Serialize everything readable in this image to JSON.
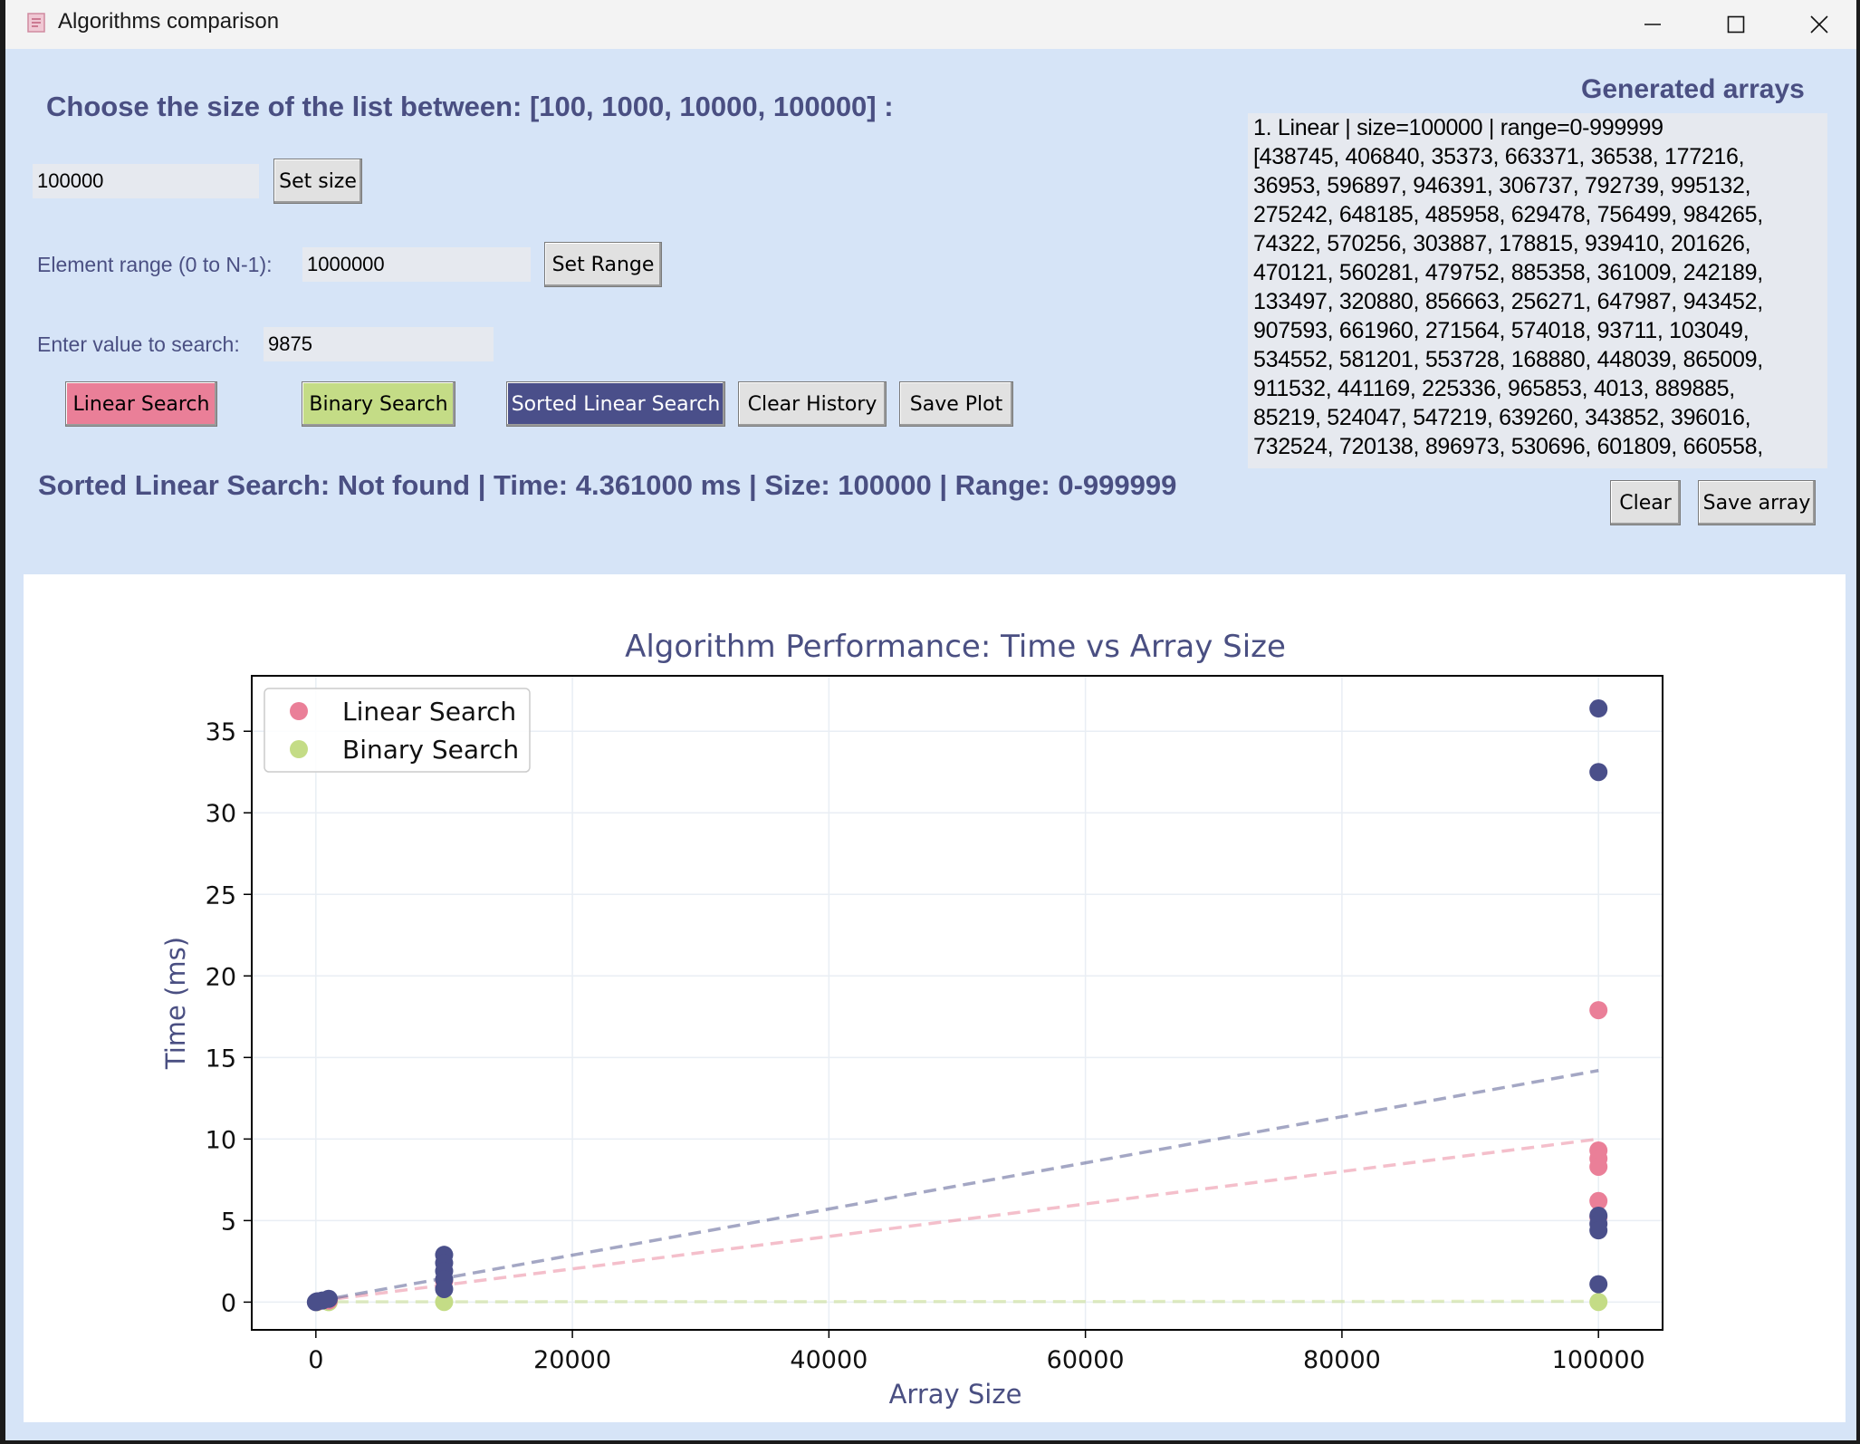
{
  "window": {
    "title": "Algorithms comparison"
  },
  "controls": {
    "size_prompt": "Choose the size of the list between: [100, 1000, 10000, 100000] :",
    "size_value": "100000",
    "set_size_label": "Set size",
    "range_label": "Element range (0 to N-1):",
    "range_value": "1000000",
    "set_range_label": "Set Range",
    "search_label": "Enter value to search:",
    "search_value": "9875",
    "linear_label": "Linear Search",
    "binary_label": "Binary Search",
    "sorted_label": "Sorted Linear Search",
    "clear_history_label": "Clear History",
    "save_plot_label": "Save Plot"
  },
  "status": "Sorted Linear Search: Not found | Time: 4.361000 ms | Size: 100000 | Range: 0-999999",
  "generated": {
    "title": "Generated arrays",
    "lines": [
      "1. Linear | size=100000 | range=0-999999",
      "[438745, 406840, 35373, 663371, 36538, 177216,",
      "36953, 596897, 946391, 306737, 792739, 995132,",
      "275242, 648185, 485958, 629478, 756499, 984265,",
      "74322, 570256, 303887, 178815, 939410, 201626,",
      "470121, 560281, 479752, 885358, 361009, 242189,",
      "133497, 320880, 856663, 256271, 647987, 943452,",
      "907593, 661960, 271564, 574018, 93711, 103049,",
      "534552, 581201, 553728, 168880, 448039, 865009,",
      "911532, 441169, 225336, 965853, 4013, 889885,",
      "85219, 524047, 547219, 639260, 343852, 396016,",
      "732524, 720138, 896973, 530696, 601809, 660558,"
    ],
    "clear_label": "Clear",
    "save_label": "Save array"
  },
  "colors": {
    "linear": "#ea7f98",
    "binary": "#c4dc86",
    "sorted": "#4a4f8a",
    "accent_text": "#4a4f82"
  },
  "chart_data": {
    "type": "scatter",
    "title": "Algorithm Performance: Time vs Array Size",
    "xlabel": "Array Size",
    "ylabel": "Time (ms)",
    "xlim": [
      -5000,
      105000
    ],
    "ylim": [
      -1.7,
      38.4
    ],
    "xticks": [
      0,
      20000,
      40000,
      60000,
      80000,
      100000
    ],
    "yticks": [
      0,
      5,
      10,
      15,
      20,
      25,
      30,
      35
    ],
    "grid": true,
    "legend": {
      "position": "top-left",
      "entries": [
        "Linear Search",
        "Binary Search"
      ]
    },
    "series": [
      {
        "name": "Linear Search",
        "color": "#ea7f98",
        "x": [
          100,
          1000,
          10000,
          100000,
          100000,
          100000,
          100000,
          100000,
          100000
        ],
        "y": [
          0.02,
          0.1,
          1.3,
          17.9,
          9.3,
          8.8,
          8.3,
          6.2,
          5.2
        ],
        "trend": [
          [
            0,
            0.05
          ],
          [
            100000,
            10.0
          ]
        ]
      },
      {
        "name": "Binary Search",
        "color": "#c4dc86",
        "x": [
          100,
          1000,
          10000,
          100000
        ],
        "y": [
          0.0,
          0.0,
          0.01,
          0.01
        ],
        "trend": [
          [
            0,
            0.02
          ],
          [
            100000,
            0.05
          ]
        ]
      },
      {
        "color": "#4a4f8a",
        "x": [
          0,
          100,
          500,
          1000,
          10000,
          10000,
          10000,
          10000,
          10000,
          100000,
          100000,
          100000,
          100000,
          100000,
          100000
        ],
        "y": [
          0.0,
          0.05,
          0.1,
          0.2,
          2.9,
          2.4,
          1.9,
          1.4,
          0.8,
          36.4,
          32.5,
          5.3,
          4.8,
          4.4,
          1.1
        ],
        "trend": [
          [
            0,
            0.05
          ],
          [
            100000,
            14.2
          ]
        ]
      }
    ]
  }
}
